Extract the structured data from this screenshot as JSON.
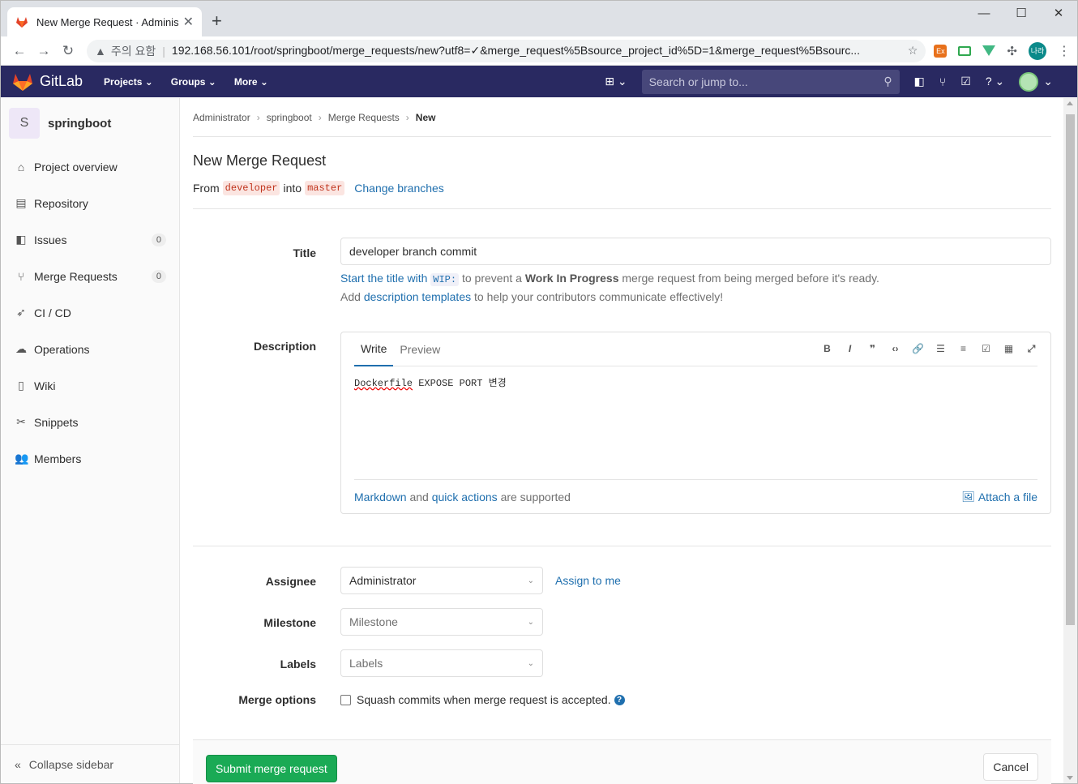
{
  "browser": {
    "tab_title": "New Merge Request · Administr",
    "security_warning": "주의 요함",
    "url": "192.168.56.101/root/springboot/merge_requests/new?utf8=✓&merge_request%5Bsource_project_id%5D=1&merge_request%5Bsourc...",
    "profile_initials": "나라"
  },
  "gitlab_nav": {
    "brand": "GitLab",
    "menu": [
      "Projects",
      "Groups",
      "More"
    ],
    "search_placeholder": "Search or jump to..."
  },
  "sidebar": {
    "project_initial": "S",
    "project_name": "springboot",
    "items": [
      {
        "label": "Project overview",
        "icon": "home-icon"
      },
      {
        "label": "Repository",
        "icon": "doc-icon"
      },
      {
        "label": "Issues",
        "icon": "issues-icon",
        "count": "0"
      },
      {
        "label": "Merge Requests",
        "icon": "merge-icon",
        "count": "0"
      },
      {
        "label": "CI / CD",
        "icon": "rocket-icon"
      },
      {
        "label": "Operations",
        "icon": "cloud-icon"
      },
      {
        "label": "Wiki",
        "icon": "book-icon"
      },
      {
        "label": "Snippets",
        "icon": "scissors-icon"
      },
      {
        "label": "Members",
        "icon": "users-icon"
      }
    ],
    "collapse_label": "Collapse sidebar"
  },
  "breadcrumb": [
    "Administrator",
    "springboot",
    "Merge Requests",
    "New"
  ],
  "page": {
    "title": "New Merge Request",
    "from_label": "From",
    "source_branch": "developer",
    "into_label": "into",
    "target_branch": "master",
    "change_branches": "Change branches"
  },
  "form": {
    "title_label": "Title",
    "title_value": "developer branch commit",
    "wip_hint_link": "Start the title with",
    "wip_code": "WIP:",
    "wip_hint_mid": "to prevent a",
    "wip_hint_bold": "Work In Progress",
    "wip_hint_end": "merge request from being merged before it's ready.",
    "template_hint_start": "Add",
    "template_hint_link": "description templates",
    "template_hint_end": "to help your contributors communicate effectively!",
    "description_label": "Description",
    "tab_write": "Write",
    "tab_preview": "Preview",
    "description_word1": "Dockerfile",
    "description_rest": " EXPOSE PORT 변경",
    "markdown_link": "Markdown",
    "and_text": "and",
    "quick_actions_link": "quick actions",
    "supported_text": "are supported",
    "attach_file": "Attach a file",
    "assignee_label": "Assignee",
    "assignee_value": "Administrator",
    "assign_to_me": "Assign to me",
    "milestone_label": "Milestone",
    "milestone_placeholder": "Milestone",
    "labels_label": "Labels",
    "labels_placeholder": "Labels",
    "merge_options_label": "Merge options",
    "squash_label": "Squash commits when merge request is accepted.",
    "submit": "Submit merge request",
    "cancel": "Cancel"
  },
  "colors": {
    "nav_bg": "#292961",
    "submit_green": "#1aaa55",
    "link_blue": "#1f6fae"
  }
}
